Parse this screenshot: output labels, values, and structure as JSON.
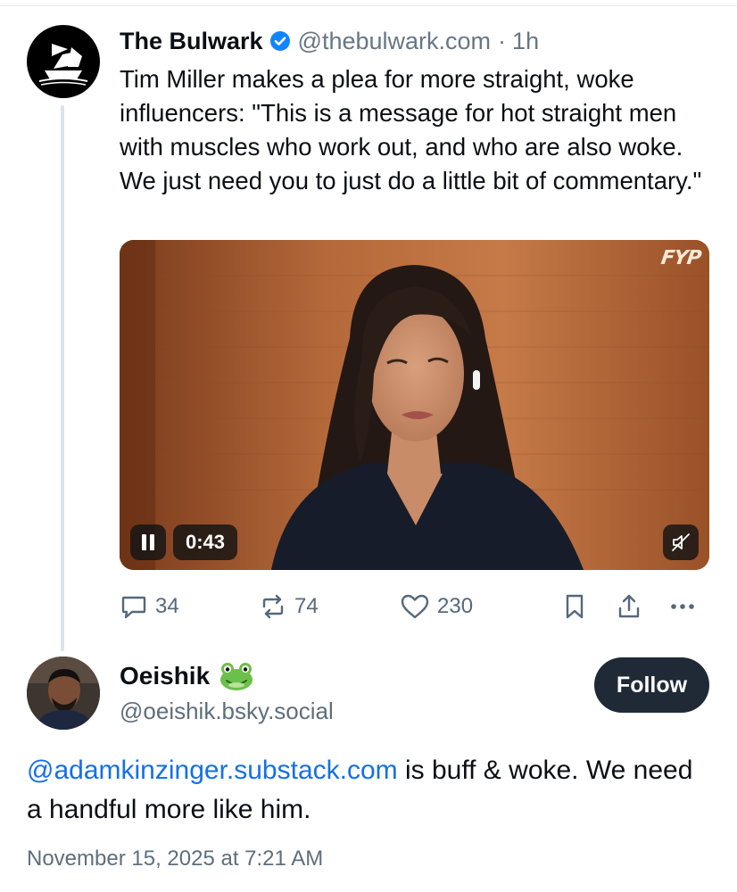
{
  "parent_post": {
    "author_name": "The Bulwark",
    "verified": true,
    "handle": "@thebulwark.com",
    "separator": "·",
    "age": "1h",
    "text": "Tim Miller makes a plea for more straight, woke influencers: \"This is a message for hot straight men with muscles who work out, and who are also woke. We just need you to just do a little bit of commentary.\"",
    "video": {
      "watermark": "FYP",
      "state": "playing",
      "time": "0:43",
      "muted": true
    },
    "actions": {
      "replies": "34",
      "reposts": "74",
      "likes": "230"
    }
  },
  "reply_post": {
    "author_name": "Oeishik",
    "name_emoji": "frog-emoji",
    "handle": "@oeishik.bsky.social",
    "follow_label": "Follow",
    "mention": "@adamkinzinger.substack.com",
    "text_after_mention": " is buff & woke. We need a handful more like him.",
    "timestamp": "November 15, 2025 at 7:21 AM"
  },
  "icons": {
    "reply": "speech-bubble-icon",
    "repost": "repost-arrows-icon",
    "like": "heart-icon",
    "bookmark": "bookmark-icon",
    "share": "share-icon",
    "more": "ellipsis-icon",
    "pause": "pause-icon",
    "mute": "speaker-muted-icon",
    "verified": "verified-check-icon"
  },
  "colors": {
    "accent": "#1470e6",
    "verified": "#1185fe",
    "muted_text": "#687684",
    "follow_bg": "#1f2a36"
  }
}
